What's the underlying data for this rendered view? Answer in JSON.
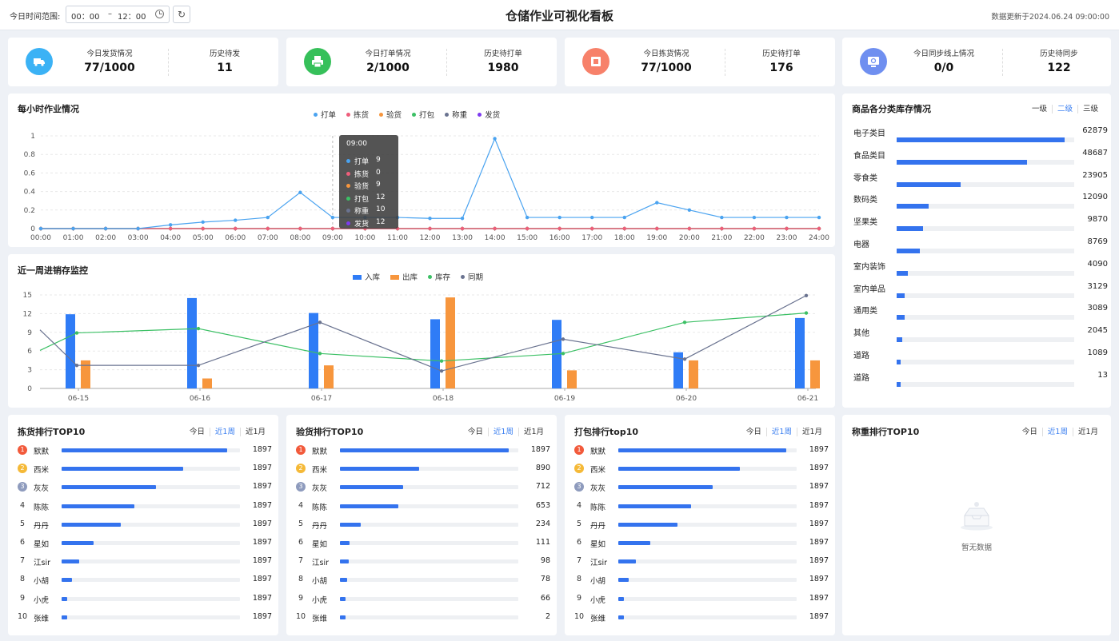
{
  "header": {
    "title": "仓储作业可视化看板",
    "range_label": "今日时间范围:",
    "range_start": "00：00",
    "range_sep": "–",
    "range_end": "12：00",
    "updated": "数据更新于2024.06.24 09:00:00"
  },
  "stats": [
    {
      "icon": "truck-icon",
      "color": "#3bb2f5",
      "label": "今日发货情况",
      "value": "77/1000",
      "hist_label": "历史待发",
      "hist_value": "11"
    },
    {
      "icon": "printer-icon",
      "color": "#36c05a",
      "label": "今日打单情况",
      "value": "2/1000",
      "hist_label": "历史待打单",
      "hist_value": "1980"
    },
    {
      "icon": "picking-icon",
      "color": "#f7816a",
      "label": "今日拣货情况",
      "value": "77/1000",
      "hist_label": "历史待打单",
      "hist_value": "176"
    },
    {
      "icon": "sync-icon",
      "color": "#6f8ff0",
      "label": "今日同步线上情况",
      "value": "0/0",
      "hist_label": "历史待同步",
      "hist_value": "122"
    }
  ],
  "hourly": {
    "title": "每小时作业情况",
    "tooltip": {
      "time": "09:00",
      "rows": [
        {
          "name": "打单",
          "value": "9"
        },
        {
          "name": "拣货",
          "value": "0"
        },
        {
          "name": "验货",
          "value": "9"
        },
        {
          "name": "打包",
          "value": "12"
        },
        {
          "name": "称重",
          "value": "10"
        },
        {
          "name": "发货",
          "value": "12"
        }
      ]
    }
  },
  "weekly": {
    "title": "近一周进销存监控"
  },
  "category": {
    "title": "商品各分类库存情况",
    "tabs": [
      "一级",
      "二级",
      "三级"
    ],
    "active_tab": 1,
    "items": [
      {
        "name": "电子类目",
        "value": 62879,
        "label": "62879"
      },
      {
        "name": "食品类目",
        "value": 48687,
        "label": "48687"
      },
      {
        "name": "零食类",
        "value": 23905,
        "label": "23905"
      },
      {
        "name": "数码类",
        "value": 12090,
        "label": "12090"
      },
      {
        "name": "坚果类",
        "value": 9870,
        "label": "9870"
      },
      {
        "name": "电器",
        "value": 8769,
        "label": "8769"
      },
      {
        "name": "室内装饰",
        "value": 4090,
        "label": "4090"
      },
      {
        "name": "室内单品",
        "value": 3129,
        "label": "3129"
      },
      {
        "name": "通用类",
        "value": 3089,
        "label": "3089"
      },
      {
        "name": "其他",
        "value": 2045,
        "label": "2045"
      },
      {
        "name": "道路",
        "value": 1089,
        "label": "1089"
      },
      {
        "name": "道路",
        "value": 13,
        "label": "13"
      }
    ]
  },
  "rank_tabs": [
    "今日",
    "近1周",
    "近1月"
  ],
  "rank_active_tab": 1,
  "medal_colors": [
    "#f25a3b",
    "#f5b937",
    "#8e9bbd"
  ],
  "rankings": [
    {
      "title": "拣货排行TOP10",
      "items": [
        {
          "name": "默默",
          "fill": 0.93,
          "label": "1897"
        },
        {
          "name": "西米",
          "fill": 0.68,
          "label": "1897"
        },
        {
          "name": "灰灰",
          "fill": 0.53,
          "label": "1897"
        },
        {
          "name": "陈陈",
          "fill": 0.41,
          "label": "1897"
        },
        {
          "name": "丹丹",
          "fill": 0.33,
          "label": "1897"
        },
        {
          "name": "星如",
          "fill": 0.18,
          "label": "1897"
        },
        {
          "name": "江sir",
          "fill": 0.1,
          "label": "1897"
        },
        {
          "name": "小胡",
          "fill": 0.06,
          "label": "1897"
        },
        {
          "name": "小虎",
          "fill": 0.03,
          "label": "1897"
        },
        {
          "name": "张维",
          "fill": 0.03,
          "label": "1897"
        }
      ]
    },
    {
      "title": "验货排行TOP10",
      "items": [
        {
          "name": "默默",
          "value": 1897,
          "label": "1897"
        },
        {
          "name": "西米",
          "value": 890,
          "label": "890"
        },
        {
          "name": "灰灰",
          "value": 712,
          "label": "712"
        },
        {
          "name": "陈陈",
          "value": 653,
          "label": "653"
        },
        {
          "name": "丹丹",
          "value": 234,
          "label": "234"
        },
        {
          "name": "星如",
          "value": 111,
          "label": "111"
        },
        {
          "name": "江sir",
          "value": 98,
          "label": "98"
        },
        {
          "name": "小胡",
          "value": 78,
          "label": "78"
        },
        {
          "name": "小虎",
          "value": 66,
          "label": "66"
        },
        {
          "name": "张维",
          "value": 2,
          "label": "2"
        }
      ]
    },
    {
      "title": "打包排行top10",
      "items": [
        {
          "name": "默默",
          "fill": 0.94,
          "label": "1897"
        },
        {
          "name": "西米",
          "fill": 0.68,
          "label": "1897"
        },
        {
          "name": "灰灰",
          "fill": 0.53,
          "label": "1897"
        },
        {
          "name": "陈陈",
          "fill": 0.41,
          "label": "1897"
        },
        {
          "name": "丹丹",
          "fill": 0.33,
          "label": "1897"
        },
        {
          "name": "星如",
          "fill": 0.18,
          "label": "1897"
        },
        {
          "name": "江sir",
          "fill": 0.1,
          "label": "1897"
        },
        {
          "name": "小胡",
          "fill": 0.06,
          "label": "1897"
        },
        {
          "name": "小虎",
          "fill": 0.03,
          "label": "1897"
        },
        {
          "name": "张维",
          "fill": 0.03,
          "label": "1897"
        }
      ]
    }
  ],
  "weigh_rank": {
    "title": "称重排行TOP10",
    "empty_text": "暂无数据"
  },
  "chart_data": [
    {
      "type": "line",
      "x": [
        "00:00",
        "01:00",
        "02:00",
        "03:00",
        "04:00",
        "05:00",
        "06:00",
        "07:00",
        "08:00",
        "09:00",
        "10:00",
        "11:00",
        "12:00",
        "13:00",
        "14:00",
        "15:00",
        "16:00",
        "17:00",
        "18:00",
        "19:00",
        "20:00",
        "21:00",
        "22:00",
        "23:00",
        "24:00"
      ],
      "yticks": [
        "0",
        "0.2",
        "0.4",
        "0.6",
        "0.8",
        "1"
      ],
      "ylim": [
        0,
        1
      ],
      "grid": true,
      "legend_position": "top-center",
      "series": [
        {
          "name": "打单",
          "color": "#4aa3f0",
          "values": [
            0,
            0,
            0,
            0,
            0.04,
            0.07,
            0.09,
            0.12,
            0.39,
            0.12,
            0.12,
            0.12,
            0.11,
            0.11,
            0.97,
            0.12,
            0.12,
            0.12,
            0.12,
            0.28,
            0.2,
            0.12,
            0.12,
            0.12,
            0.12
          ]
        },
        {
          "name": "拣货",
          "color": "#ee5e7b",
          "values": [
            0,
            0,
            0,
            0,
            0,
            0,
            0,
            0,
            0,
            0,
            0,
            0,
            0,
            0,
            0,
            0,
            0,
            0,
            0,
            0,
            0,
            0,
            0,
            0,
            0
          ]
        },
        {
          "name": "验货",
          "color": "#f7963d",
          "values": [
            0,
            0,
            0,
            0,
            0,
            0,
            0,
            0,
            0,
            0,
            0,
            0,
            0,
            0,
            0,
            0,
            0,
            0,
            0,
            0,
            0,
            0,
            0,
            0,
            0
          ]
        },
        {
          "name": "打包",
          "color": "#3cc065",
          "values": [
            0,
            0,
            0,
            0,
            0,
            0,
            0,
            0,
            0,
            0,
            0,
            0,
            0,
            0,
            0,
            0,
            0,
            0,
            0,
            0,
            0,
            0,
            0,
            0,
            0
          ]
        },
        {
          "name": "称重",
          "color": "#6a7390",
          "values": [
            0,
            0,
            0,
            0,
            0,
            0,
            0,
            0,
            0,
            0,
            0,
            0,
            0,
            0,
            0,
            0,
            0,
            0,
            0,
            0,
            0,
            0,
            0,
            0,
            0
          ]
        },
        {
          "name": "发货",
          "color": "#7e3bf0",
          "values": [
            0,
            0,
            0,
            0,
            0,
            0,
            0,
            0,
            0,
            0,
            0,
            0,
            0,
            0,
            0,
            0,
            0,
            0,
            0,
            0,
            0,
            0,
            0,
            0,
            0
          ]
        }
      ]
    },
    {
      "type": "bar",
      "categories": [
        "06-15",
        "06-16",
        "06-17",
        "06-18",
        "06-19",
        "06-20",
        "06-21"
      ],
      "yticks": [
        "0",
        "3",
        "6",
        "9",
        "12",
        "15"
      ],
      "ylim": [
        0,
        15
      ],
      "grid": true,
      "legend_position": "top-center",
      "series": [
        {
          "name": "入库",
          "kind": "bar",
          "color": "#2f7cf6",
          "values": [
            11.9,
            14.5,
            12.1,
            11.1,
            11,
            5.8,
            11.3
          ]
        },
        {
          "name": "出库",
          "kind": "bar",
          "color": "#f7963d",
          "values": [
            4.5,
            1.6,
            3.7,
            14.6,
            2.9,
            4.5,
            4.5
          ]
        },
        {
          "name": "库存",
          "kind": "line",
          "color": "#3cc065",
          "values": [
            8.9,
            9.6,
            5.6,
            4.4,
            5.6,
            10.6,
            12.1
          ],
          "start": 6.1
        },
        {
          "name": "同期",
          "kind": "line",
          "color": "#6a7390",
          "values": [
            3.7,
            3.7,
            10.6,
            2.8,
            7.9,
            4.7,
            14.9
          ],
          "start": 9.4
        }
      ]
    }
  ]
}
